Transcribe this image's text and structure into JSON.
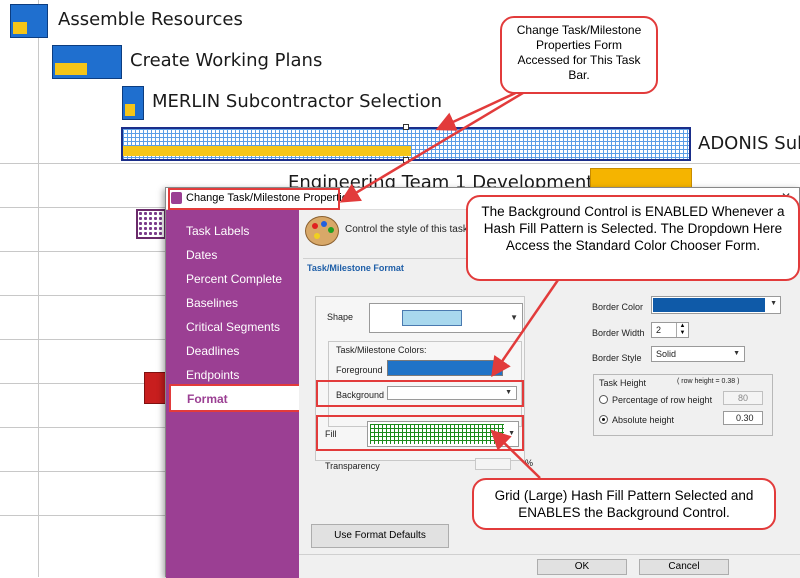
{
  "gantt": {
    "tasks": [
      {
        "label": "Assemble Resources"
      },
      {
        "label": "Create Working Plans"
      },
      {
        "label": "MERLIN Subcontractor Selection"
      },
      {
        "label": "ADONIS Sub"
      },
      {
        "label": "Engineering Team 1 Development"
      }
    ]
  },
  "dialog": {
    "title": "Change Task/Milestone Properties",
    "sidebar": {
      "items": [
        {
          "label": "Task Labels"
        },
        {
          "label": "Dates"
        },
        {
          "label": "Percent Complete"
        },
        {
          "label": "Baselines"
        },
        {
          "label": "Critical Segments"
        },
        {
          "label": "Deadlines"
        },
        {
          "label": "Endpoints"
        },
        {
          "label": "Format"
        }
      ],
      "active": "Format"
    },
    "header_text": "Control the style of this task",
    "section_title": "Task/Milestone Format",
    "shape_label": "Shape",
    "colors_group_label": "Task/Milestone Colors:",
    "foreground_label": "Foreground",
    "background_label": "Background",
    "fill_label": "Fill",
    "transparency_label": "Transparency",
    "transparency_unit": "%",
    "border_color_label": "Border Color",
    "border_width_label": "Border Width",
    "border_width_value": "2",
    "border_style_label": "Border Style",
    "border_style_value": "Solid",
    "task_height_label": "Task Height",
    "row_height_note": "( row height = 0.38 )",
    "percentage_label": "Percentage of row height",
    "percentage_value": "80",
    "absolute_label": "Absolute height",
    "absolute_value": "0.30",
    "use_defaults_label": "Use Format Defaults",
    "ok_label": "OK",
    "cancel_label": "Cancel",
    "colors": {
      "shape_fill": "#a8d8ee",
      "foreground": "#1f73c7",
      "border_color": "#0f5aa8",
      "fill_hash": "#1a8a1a"
    }
  },
  "callouts": {
    "top": "Change Task/Milestone Properties Form Accessed for This Task Bar.",
    "right": "The Background Control is ENABLED Whenever a Hash Fill Pattern is Selected.  The Dropdown Here Access the Standard Color Chooser Form.",
    "bottom": "Grid (Large) Hash Fill Pattern Selected and ENABLES the Background Control."
  }
}
